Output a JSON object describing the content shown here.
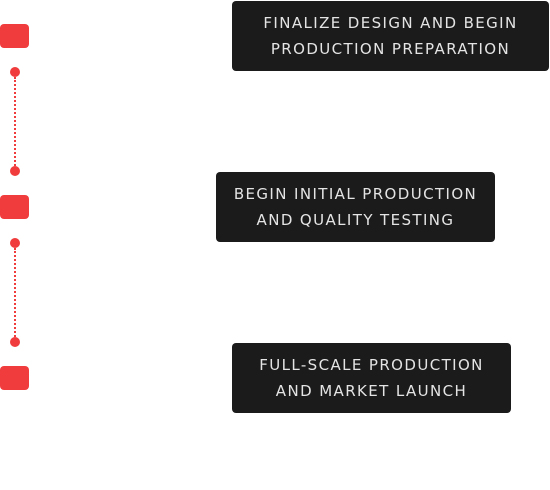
{
  "accent_color": "#f03c3c",
  "card_color": "#1b1b1b",
  "steps": [
    {
      "label": "Finalize design and begin\nproduction preparation"
    },
    {
      "label": "Begin initial production\nand quality testing"
    },
    {
      "label": "Full-scale production\nand market launch"
    }
  ]
}
